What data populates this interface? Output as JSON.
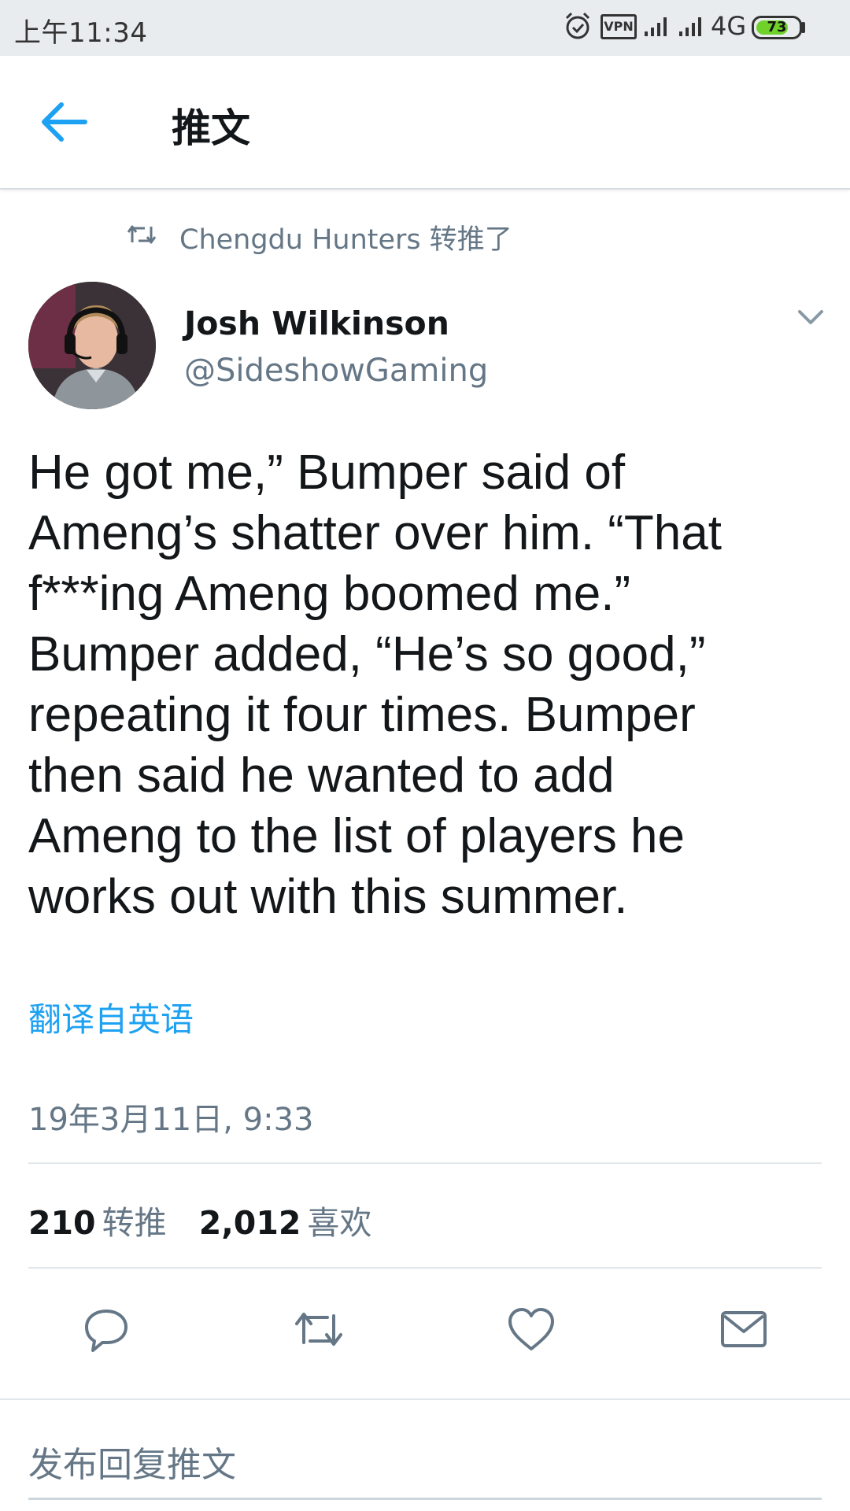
{
  "status_bar": {
    "time": "上午11:34",
    "vpn_label": "VPN",
    "network_label": "4G",
    "battery_percent": "73",
    "icons": [
      "alarm-icon",
      "vpn-icon",
      "signal-icon",
      "signal-icon",
      "battery-icon"
    ]
  },
  "header": {
    "back_icon": "arrow-left-icon",
    "title": "推文"
  },
  "tweet": {
    "retweet_context": "Chengdu Hunters 转推了",
    "author": {
      "name": "Josh Wilkinson",
      "handle": "@SideshowGaming"
    },
    "text_lines": [
      "He got me,” Bumper said of",
      "Ameng’s shatter over him. “That",
      "f***ing Ameng boomed me.”",
      "Bumper added, “He’s so good,”",
      "repeating it four times. Bumper",
      "then said he wanted to add",
      "Ameng to the list of players he",
      "works out with this summer."
    ],
    "translate_label": "翻译自英语",
    "timestamp": "19年3月11日, 9:33",
    "stats": {
      "retweets_count": "210",
      "retweets_label": "转推",
      "likes_count": "2,012",
      "likes_label": "喜欢"
    },
    "actions": [
      "reply-icon",
      "retweet-icon",
      "like-icon",
      "message-icon"
    ]
  },
  "reply_bar": {
    "placeholder": "发布回复推文"
  },
  "colors": {
    "accent": "#1da1f2",
    "secondary_text": "#657786",
    "primary_text": "#14171a",
    "status_bar_bg": "#e9ecef",
    "battery_fill": "#6fd12a"
  }
}
